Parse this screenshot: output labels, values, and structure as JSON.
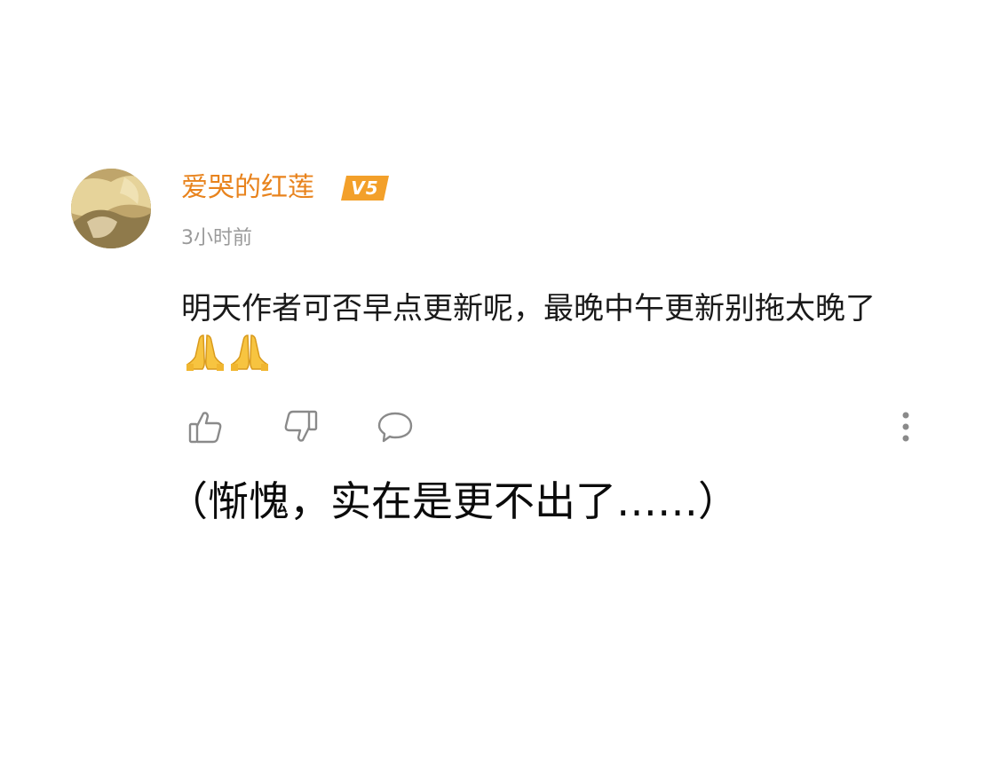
{
  "comment": {
    "username": "爱哭的红莲",
    "level_badge": "V5",
    "timestamp": "3小时前",
    "text": "明天作者可否早点更新呢，最晚中午更新别拖太晚了",
    "emojis": [
      "folded-hands",
      "folded-hands"
    ]
  },
  "actions": {
    "like_icon": "thumbs-up-icon",
    "dislike_icon": "thumbs-down-icon",
    "reply_icon": "comment-bubble-icon",
    "more_icon": "more-vertical-icon"
  },
  "caption": "（惭愧，实在是更不出了……）",
  "colors": {
    "username": "#e8831d",
    "badge": "#f3a02a",
    "timestamp": "#9a9a9a",
    "text": "#1a1a1a",
    "icons": "#8a8a8a"
  }
}
